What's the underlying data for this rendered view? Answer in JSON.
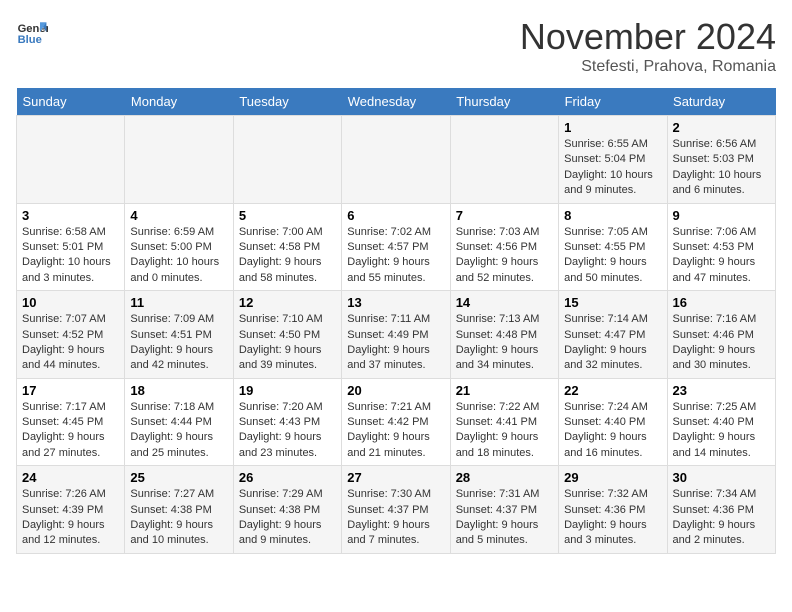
{
  "logo": {
    "line1": "General",
    "line2": "Blue"
  },
  "title": {
    "month": "November 2024",
    "location": "Stefesti, Prahova, Romania"
  },
  "weekdays": [
    "Sunday",
    "Monday",
    "Tuesday",
    "Wednesday",
    "Thursday",
    "Friday",
    "Saturday"
  ],
  "weeks": [
    [
      {
        "day": "",
        "info": ""
      },
      {
        "day": "",
        "info": ""
      },
      {
        "day": "",
        "info": ""
      },
      {
        "day": "",
        "info": ""
      },
      {
        "day": "",
        "info": ""
      },
      {
        "day": "1",
        "info": "Sunrise: 6:55 AM\nSunset: 5:04 PM\nDaylight: 10 hours\nand 9 minutes."
      },
      {
        "day": "2",
        "info": "Sunrise: 6:56 AM\nSunset: 5:03 PM\nDaylight: 10 hours\nand 6 minutes."
      }
    ],
    [
      {
        "day": "3",
        "info": "Sunrise: 6:58 AM\nSunset: 5:01 PM\nDaylight: 10 hours\nand 3 minutes."
      },
      {
        "day": "4",
        "info": "Sunrise: 6:59 AM\nSunset: 5:00 PM\nDaylight: 10 hours\nand 0 minutes."
      },
      {
        "day": "5",
        "info": "Sunrise: 7:00 AM\nSunset: 4:58 PM\nDaylight: 9 hours\nand 58 minutes."
      },
      {
        "day": "6",
        "info": "Sunrise: 7:02 AM\nSunset: 4:57 PM\nDaylight: 9 hours\nand 55 minutes."
      },
      {
        "day": "7",
        "info": "Sunrise: 7:03 AM\nSunset: 4:56 PM\nDaylight: 9 hours\nand 52 minutes."
      },
      {
        "day": "8",
        "info": "Sunrise: 7:05 AM\nSunset: 4:55 PM\nDaylight: 9 hours\nand 50 minutes."
      },
      {
        "day": "9",
        "info": "Sunrise: 7:06 AM\nSunset: 4:53 PM\nDaylight: 9 hours\nand 47 minutes."
      }
    ],
    [
      {
        "day": "10",
        "info": "Sunrise: 7:07 AM\nSunset: 4:52 PM\nDaylight: 9 hours\nand 44 minutes."
      },
      {
        "day": "11",
        "info": "Sunrise: 7:09 AM\nSunset: 4:51 PM\nDaylight: 9 hours\nand 42 minutes."
      },
      {
        "day": "12",
        "info": "Sunrise: 7:10 AM\nSunset: 4:50 PM\nDaylight: 9 hours\nand 39 minutes."
      },
      {
        "day": "13",
        "info": "Sunrise: 7:11 AM\nSunset: 4:49 PM\nDaylight: 9 hours\nand 37 minutes."
      },
      {
        "day": "14",
        "info": "Sunrise: 7:13 AM\nSunset: 4:48 PM\nDaylight: 9 hours\nand 34 minutes."
      },
      {
        "day": "15",
        "info": "Sunrise: 7:14 AM\nSunset: 4:47 PM\nDaylight: 9 hours\nand 32 minutes."
      },
      {
        "day": "16",
        "info": "Sunrise: 7:16 AM\nSunset: 4:46 PM\nDaylight: 9 hours\nand 30 minutes."
      }
    ],
    [
      {
        "day": "17",
        "info": "Sunrise: 7:17 AM\nSunset: 4:45 PM\nDaylight: 9 hours\nand 27 minutes."
      },
      {
        "day": "18",
        "info": "Sunrise: 7:18 AM\nSunset: 4:44 PM\nDaylight: 9 hours\nand 25 minutes."
      },
      {
        "day": "19",
        "info": "Sunrise: 7:20 AM\nSunset: 4:43 PM\nDaylight: 9 hours\nand 23 minutes."
      },
      {
        "day": "20",
        "info": "Sunrise: 7:21 AM\nSunset: 4:42 PM\nDaylight: 9 hours\nand 21 minutes."
      },
      {
        "day": "21",
        "info": "Sunrise: 7:22 AM\nSunset: 4:41 PM\nDaylight: 9 hours\nand 18 minutes."
      },
      {
        "day": "22",
        "info": "Sunrise: 7:24 AM\nSunset: 4:40 PM\nDaylight: 9 hours\nand 16 minutes."
      },
      {
        "day": "23",
        "info": "Sunrise: 7:25 AM\nSunset: 4:40 PM\nDaylight: 9 hours\nand 14 minutes."
      }
    ],
    [
      {
        "day": "24",
        "info": "Sunrise: 7:26 AM\nSunset: 4:39 PM\nDaylight: 9 hours\nand 12 minutes."
      },
      {
        "day": "25",
        "info": "Sunrise: 7:27 AM\nSunset: 4:38 PM\nDaylight: 9 hours\nand 10 minutes."
      },
      {
        "day": "26",
        "info": "Sunrise: 7:29 AM\nSunset: 4:38 PM\nDaylight: 9 hours\nand 9 minutes."
      },
      {
        "day": "27",
        "info": "Sunrise: 7:30 AM\nSunset: 4:37 PM\nDaylight: 9 hours\nand 7 minutes."
      },
      {
        "day": "28",
        "info": "Sunrise: 7:31 AM\nSunset: 4:37 PM\nDaylight: 9 hours\nand 5 minutes."
      },
      {
        "day": "29",
        "info": "Sunrise: 7:32 AM\nSunset: 4:36 PM\nDaylight: 9 hours\nand 3 minutes."
      },
      {
        "day": "30",
        "info": "Sunrise: 7:34 AM\nSunset: 4:36 PM\nDaylight: 9 hours\nand 2 minutes."
      }
    ]
  ]
}
